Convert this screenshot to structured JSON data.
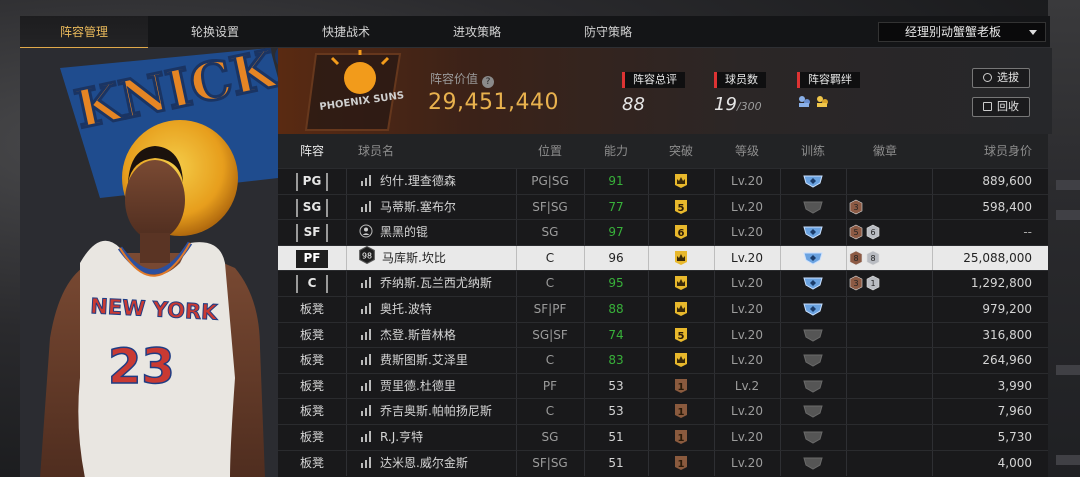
{
  "tabs": [
    {
      "label": "阵容管理",
      "active": true
    },
    {
      "label": "轮换设置",
      "active": false
    },
    {
      "label": "快捷战术",
      "active": false
    },
    {
      "label": "进攻策略",
      "active": false
    },
    {
      "label": "防守策略",
      "active": false
    }
  ],
  "team_select": {
    "value": "经理别动蟹蟹老板"
  },
  "header": {
    "team_logo_text": "PHOENIX SUNS",
    "value_label": "阵容价值",
    "value": "29,451,440",
    "rating_label": "阵容总评",
    "rating": "88",
    "players_label": "球员数",
    "players_count": "19",
    "players_max": "/300",
    "chem_label": "阵容羁绊",
    "filter_button": "选拔",
    "recycle_button": "回收"
  },
  "left_art": {
    "logo_text": "KNICKS",
    "jersey_text": "NEW YORK",
    "jersey_number": "23"
  },
  "table": {
    "headers": [
      "阵容",
      "球员名",
      "位置",
      "能力",
      "突破",
      "等级",
      "训练",
      "徽章",
      "球员身价"
    ],
    "rows": [
      {
        "slot": "PG",
        "starter": true,
        "name": "约什.理查德森",
        "pos": "PG|SG",
        "ovr": "91",
        "green": true,
        "break": "crown",
        "level": "Lv.20",
        "train": "blue",
        "medals": [],
        "value": "889,600",
        "icon": "bars"
      },
      {
        "slot": "SG",
        "starter": true,
        "name": "马蒂斯.塞布尔",
        "pos": "SF|SG",
        "ovr": "77",
        "green": true,
        "break": "5",
        "level": "Lv.20",
        "train": "gray",
        "medals": [
          "3"
        ],
        "value": "598,400",
        "icon": "bars"
      },
      {
        "slot": "SF",
        "starter": true,
        "name": "黑黑的锟",
        "pos": "SG",
        "ovr": "97",
        "green": true,
        "break": "6",
        "level": "Lv.20",
        "train": "blue",
        "medals": [
          "5",
          "6"
        ],
        "value": "--",
        "icon": "person"
      },
      {
        "slot": "PF",
        "starter": true,
        "selected": true,
        "name": "马库斯.坎比",
        "pos": "C",
        "ovr": "96",
        "green": false,
        "break": "crown",
        "level": "Lv.20",
        "train": "blue",
        "medals": [
          "8",
          "8"
        ],
        "value": "25,088,000",
        "icon": "98"
      },
      {
        "slot": "C",
        "starter": true,
        "name": "乔纳斯.瓦兰西尤纳斯",
        "pos": "C",
        "ovr": "95",
        "green": true,
        "break": "crown",
        "level": "Lv.20",
        "train": "blue",
        "medals": [
          "3",
          "1"
        ],
        "value": "1,292,800",
        "icon": "bars"
      },
      {
        "slot": "板凳",
        "starter": false,
        "name": "奥托.波特",
        "pos": "SF|PF",
        "ovr": "88",
        "green": true,
        "break": "crown",
        "level": "Lv.20",
        "train": "blue",
        "medals": [],
        "value": "979,200",
        "icon": "bars"
      },
      {
        "slot": "板凳",
        "starter": false,
        "name": "杰登.斯普林格",
        "pos": "SG|SF",
        "ovr": "74",
        "green": true,
        "break": "5",
        "level": "Lv.20",
        "train": "gray",
        "medals": [],
        "value": "316,800",
        "icon": "bars"
      },
      {
        "slot": "板凳",
        "starter": false,
        "name": "费斯图斯.艾泽里",
        "pos": "C",
        "ovr": "83",
        "green": true,
        "break": "crown",
        "level": "Lv.20",
        "train": "gray",
        "medals": [],
        "value": "264,960",
        "icon": "bars"
      },
      {
        "slot": "板凳",
        "starter": false,
        "name": "贾里德.杜德里",
        "pos": "PF",
        "ovr": "53",
        "green": false,
        "break": "1",
        "level": "Lv.2",
        "train": "gray",
        "medals": [],
        "value": "3,990",
        "icon": "bars"
      },
      {
        "slot": "板凳",
        "starter": false,
        "name": "乔吉奥斯.帕帕扬尼斯",
        "pos": "C",
        "ovr": "53",
        "green": false,
        "break": "1",
        "level": "Lv.20",
        "train": "gray",
        "medals": [],
        "value": "7,960",
        "icon": "bars"
      },
      {
        "slot": "板凳",
        "starter": false,
        "name": "R.J.亨特",
        "pos": "SG",
        "ovr": "51",
        "green": false,
        "break": "1",
        "level": "Lv.20",
        "train": "gray",
        "medals": [],
        "value": "5,730",
        "icon": "bars"
      },
      {
        "slot": "板凳",
        "starter": false,
        "name": "达米恩.威尔金斯",
        "pos": "SF|SG",
        "ovr": "51",
        "green": false,
        "break": "1",
        "level": "Lv.20",
        "train": "gray",
        "medals": [],
        "value": "4,000",
        "icon": "bars"
      }
    ]
  },
  "colors": {
    "gold": "#e9b24e",
    "green": "#38b13a",
    "red_marker": "#d33333",
    "selected_row": "#e9e9e9"
  }
}
